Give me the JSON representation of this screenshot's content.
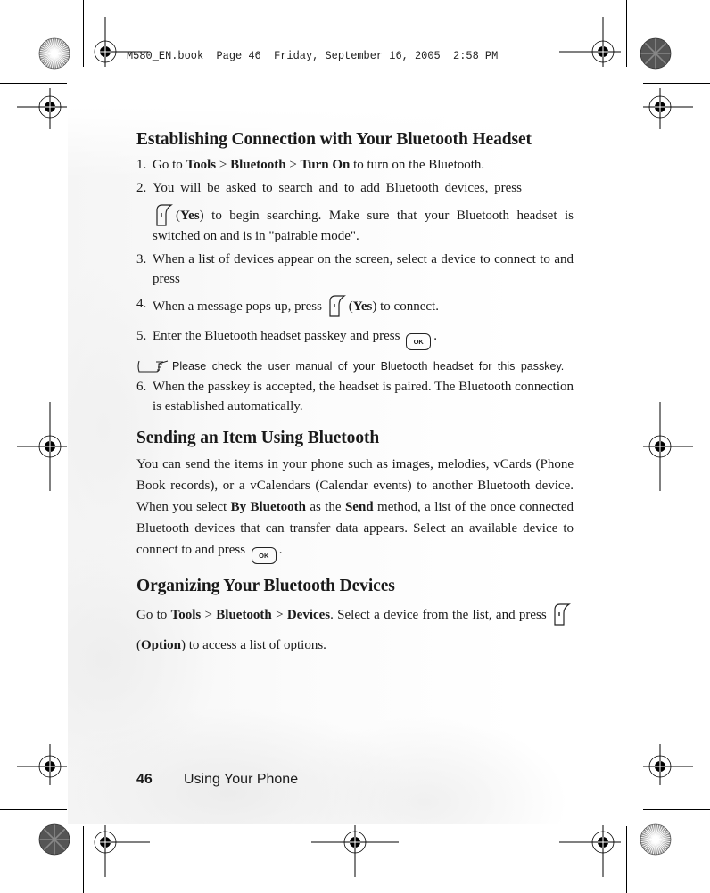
{
  "print_header": "M580_EN.book  Page 46  Friday, September 16, 2005  2:58 PM",
  "sections": {
    "establishing": {
      "title": "Establishing Connection with Your Bluetooth Headset",
      "steps": [
        {
          "num": "1.",
          "pre": "Go to ",
          "b1": "Tools",
          "sep1": " > ",
          "b2": "Bluetooth",
          "sep2": " > ",
          "b3": "Turn On",
          "post": " to turn on the Bluetooth."
        },
        {
          "num": "2.",
          "pre": "You will be asked to search and to add Bluetooth devices, press",
          "key_label": "Yes",
          "post": " to begin searching. Make sure that your Bluetooth headset is switched on and is in \"pairable mode\"."
        },
        {
          "num": "3.",
          "pre": "When a list of devices appear on the screen, select a device to connect to and press",
          "post": "."
        },
        {
          "num": "4.",
          "pre": "When a message pops up, press",
          "key_label": "Yes",
          "post": " to connect."
        },
        {
          "num": "5.",
          "pre": "Enter the Bluetooth headset passkey and press",
          "post": "."
        },
        {
          "num": "6.",
          "pre": "When the passkey is accepted, the headset is paired. The Bluetooth connection is established automatically."
        }
      ],
      "note": "Please check the user manual of your Bluetooth headset for this passkey."
    },
    "sending": {
      "title": "Sending an Item Using Bluetooth",
      "text_pre": "You can send the items in your phone such as images, melodies, vCards (Phone Book records), or a vCalendars (Calendar events) to another Bluetooth device. When you select ",
      "b1": "By Bluetooth",
      "mid": " as the ",
      "b2": "Send",
      "text_post": " method, a list of the once connected Bluetooth devices that can transfer data appears. Select an available device to connect to and press",
      "end": "."
    },
    "organizing": {
      "title": "Organizing Your Bluetooth Devices",
      "pre": "Go to ",
      "b1": "Tools",
      "sep1": " > ",
      "b2": "Bluetooth",
      "sep2": " > ",
      "b3": "Devices",
      "mid": ". Select a device from the list, and press",
      "key_label": "Option",
      "post": " to access a list of options."
    }
  },
  "keys": {
    "ok_label": "OK",
    "soft_key_icon": "left-soft-key-icon",
    "ok_key_icon": "ok-key-icon",
    "note_icon": "pointing-hand-icon"
  },
  "footer": {
    "page_number": "46",
    "chapter": "Using Your Phone"
  }
}
